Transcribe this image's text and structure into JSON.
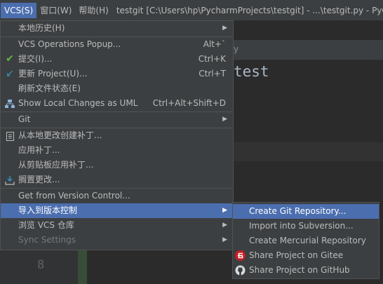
{
  "menubar": {
    "vcs": "VCS(S)",
    "window": "窗口(W)",
    "help": "帮助(H)",
    "title": "testgit [C:\\Users\\hp\\PycharmProjects\\testgit] - ...\\testgit.py - PyCh"
  },
  "editor": {
    "tab_fragment": "y",
    "text": "test",
    "gutter_line": "8"
  },
  "vcs_menu": {
    "local_history": "本地历史(H)",
    "operations_popup": "VCS Operations Popup...",
    "operations_popup_sc": "Alt+`",
    "commit": "提交(I)...",
    "commit_sc": "Ctrl+K",
    "update": "更新 Project(U)...",
    "update_sc": "Ctrl+T",
    "refresh": "刷新文件状态(E)",
    "show_uml": "Show Local Changes as UML",
    "show_uml_sc": "Ctrl+Alt+Shift+D",
    "git": "Git",
    "create_patch": "从本地更改创建补丁...",
    "apply_patch": "应用补丁...",
    "apply_clipboard": "从剪贴板应用补丁...",
    "shelve": "搁置更改...",
    "get_from_vc": "Get from Version Control...",
    "import_vc": "导入到版本控制",
    "browse_repo": "浏览 VCS 仓库",
    "sync_settings": "Sync Settings"
  },
  "import_submenu": {
    "create_git": "Create Git Repository...",
    "import_svn": "Import into Subversion...",
    "create_hg": "Create Mercurial Repository",
    "share_gitee": "Share Project on Gitee",
    "share_github": "Share Project on GitHub"
  },
  "colors": {
    "highlight": "#4b6eaf",
    "menu_bg": "#3c3f41",
    "commit_check": "#62b543",
    "update_arrow": "#3592c4",
    "gitee_red": "#c71d23"
  }
}
